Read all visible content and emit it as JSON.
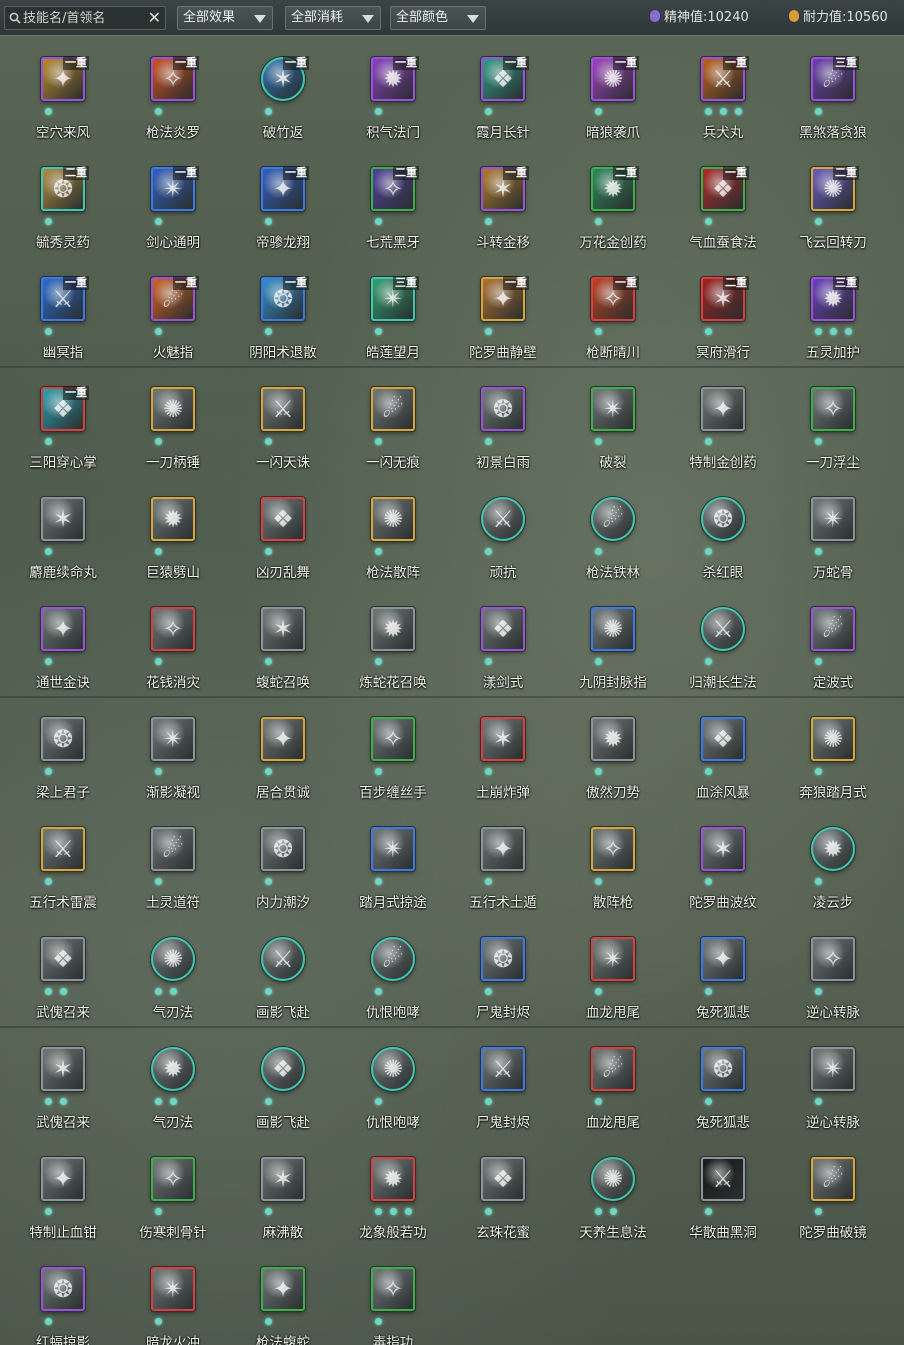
{
  "toolbar": {
    "search_placeholder": "技能名/首领名",
    "clear_glyph": "✕",
    "filter_effect": "全部效果",
    "filter_cost": "全部消耗",
    "filter_color": "全部颜色",
    "spirit_label": "精神值:",
    "spirit_value": "10240",
    "endurance_label": "耐力值:",
    "endurance_value": "10560"
  },
  "skills": [
    {
      "name": "空穴来风",
      "rank": "一重",
      "frame": "purple",
      "color": "#b8892a",
      "dots": 1
    },
    {
      "name": "枪法炎罗",
      "rank": "一重",
      "frame": "purple",
      "color": "#d0501e",
      "dots": 1
    },
    {
      "name": "破竹返",
      "rank": "一重",
      "frame": "teal",
      "color": "#2a6fb0",
      "dots": 1,
      "round": true
    },
    {
      "name": "积气法门",
      "rank": "一重",
      "frame": "purple",
      "color": "#8a3fc0",
      "dots": 1
    },
    {
      "name": "霞月长针",
      "rank": "一重",
      "frame": "purple",
      "color": "#2f9b88",
      "dots": 1
    },
    {
      "name": "暗狼袭爪",
      "rank": "一重",
      "frame": "purple",
      "color": "#a040c0",
      "dots": 1
    },
    {
      "name": "兵犬丸",
      "rank": "一重",
      "frame": "purple",
      "color": "#c0601c",
      "dots": 3
    },
    {
      "name": "黑煞落贪狼",
      "rank": "三重",
      "frame": "purple",
      "color": "#6a40b0",
      "dots": 1
    },
    {
      "name": "毓秀灵药",
      "rank": "二重",
      "frame": "teal",
      "color": "#b08a40",
      "dots": 1
    },
    {
      "name": "剑心通明",
      "rank": "一重",
      "frame": "blue",
      "color": "#3060c0",
      "dots": 1
    },
    {
      "name": "帝骖龙翔",
      "rank": "一重",
      "frame": "blue",
      "color": "#2f5fc0",
      "dots": 1
    },
    {
      "name": "七荒黑牙",
      "rank": "二重",
      "frame": "green",
      "color": "#5040a0",
      "dots": 1
    },
    {
      "name": "斗转金移",
      "rank": "一重",
      "frame": "purple",
      "color": "#b07a28",
      "dots": 1
    },
    {
      "name": "万花金创药",
      "rank": "二重",
      "frame": "green",
      "color": "#2a8a5a",
      "dots": 1
    },
    {
      "name": "气血蚕食法",
      "rank": "一重",
      "frame": "green",
      "color": "#b02a2a",
      "dots": 1
    },
    {
      "name": "飞云回转刀",
      "rank": "二重",
      "frame": "yellow",
      "color": "#6a58c0",
      "dots": 1
    },
    {
      "name": "幽冥指",
      "rank": "一重",
      "frame": "blue",
      "color": "#2a6ad0",
      "dots": 1
    },
    {
      "name": "火魅指",
      "rank": "一重",
      "frame": "purple",
      "color": "#d06020",
      "dots": 1
    },
    {
      "name": "阴阳术退散",
      "rank": "一重",
      "frame": "blue",
      "color": "#3090d0",
      "dots": 1
    },
    {
      "name": "皓莲望月",
      "rank": "三重",
      "frame": "teal",
      "color": "#30a070",
      "dots": 1
    },
    {
      "name": "陀罗曲静壁",
      "rank": "一重",
      "frame": "yellow",
      "color": "#b07030",
      "dots": 1
    },
    {
      "name": "枪断晴川",
      "rank": "一重",
      "frame": "red",
      "color": "#c04020",
      "dots": 1
    },
    {
      "name": "冥府滑行",
      "rank": "二重",
      "frame": "red",
      "color": "#a02020",
      "dots": 1
    },
    {
      "name": "五灵加护",
      "rank": "三重",
      "frame": "purple",
      "color": "#6a40c0",
      "dots": 3
    },
    {
      "name": "三阳穿心掌",
      "rank": "一重",
      "frame": "red",
      "color": "#2aa0b0",
      "dots": 1
    },
    {
      "name": "一刀柄锤",
      "frame": "yellow",
      "color": "#707878",
      "dots": 1
    },
    {
      "name": "一闪天诛",
      "frame": "yellow",
      "color": "#707878",
      "dots": 1
    },
    {
      "name": "一闪无痕",
      "frame": "yellow",
      "color": "#707878",
      "dots": 1
    },
    {
      "name": "初景白雨",
      "frame": "purple",
      "color": "#707878",
      "dots": 1
    },
    {
      "name": "破裂",
      "frame": "green",
      "color": "#707878",
      "dots": 1
    },
    {
      "name": "特制金创药",
      "frame": "gray",
      "color": "#707878",
      "dots": 1
    },
    {
      "name": "一刀浮尘",
      "frame": "green",
      "color": "#707878",
      "dots": 1
    },
    {
      "name": "麝鹿续命丸",
      "frame": "gray",
      "color": "#707878",
      "dots": 1
    },
    {
      "name": "巨猿劈山",
      "frame": "yellow",
      "color": "#707878",
      "dots": 1
    },
    {
      "name": "凶刃乱舞",
      "frame": "red",
      "color": "#707878",
      "dots": 1
    },
    {
      "name": "枪法散阵",
      "frame": "yellow",
      "color": "#707878",
      "dots": 1
    },
    {
      "name": "顽抗",
      "frame": "teal",
      "color": "#707878",
      "dots": 1,
      "round": true
    },
    {
      "name": "枪法铁林",
      "frame": "teal",
      "color": "#707878",
      "dots": 1,
      "round": true
    },
    {
      "name": "杀红眼",
      "frame": "teal",
      "color": "#707878",
      "dots": 1,
      "round": true
    },
    {
      "name": "万蛇骨",
      "frame": "gray",
      "color": "#707878",
      "dots": 1
    },
    {
      "name": "通世金诀",
      "frame": "purple",
      "color": "#707878",
      "dots": 1
    },
    {
      "name": "花钱消灾",
      "frame": "red",
      "color": "#707878",
      "dots": 1
    },
    {
      "name": "蝮蛇召唤",
      "frame": "gray",
      "color": "#707878",
      "dots": 1
    },
    {
      "name": "炼蛇花召唤",
      "frame": "gray",
      "color": "#707878",
      "dots": 1
    },
    {
      "name": "漾剑式",
      "frame": "purple",
      "color": "#707878",
      "dots": 1
    },
    {
      "name": "九阴封脉指",
      "frame": "blue",
      "color": "#707878",
      "dots": 1
    },
    {
      "name": "归潮长生法",
      "frame": "teal",
      "color": "#707878",
      "dots": 1,
      "round": true
    },
    {
      "name": "定波式",
      "frame": "purple",
      "color": "#707878",
      "dots": 1
    },
    {
      "name": "梁上君子",
      "frame": "gray",
      "color": "#707878",
      "dots": 1
    },
    {
      "name": "渐影凝视",
      "frame": "gray",
      "color": "#707878",
      "dots": 1
    },
    {
      "name": "居合贯诚",
      "frame": "yellow",
      "color": "#707878",
      "dots": 1
    },
    {
      "name": "百步缠丝手",
      "frame": "green",
      "color": "#707878",
      "dots": 1
    },
    {
      "name": "土崩炸弹",
      "frame": "red",
      "color": "#707878",
      "dots": 1
    },
    {
      "name": "傲然刀势",
      "frame": "gray",
      "color": "#707878",
      "dots": 1
    },
    {
      "name": "血涂风暴",
      "frame": "blue",
      "color": "#707878",
      "dots": 1
    },
    {
      "name": "奔狼踏月式",
      "frame": "yellow",
      "color": "#707878",
      "dots": 1
    },
    {
      "name": "五行术雷震",
      "frame": "yellow",
      "color": "#707878",
      "dots": 1
    },
    {
      "name": "土灵道符",
      "frame": "gray",
      "color": "#707878",
      "dots": 1
    },
    {
      "name": "内力潮汐",
      "frame": "gray",
      "color": "#707878",
      "dots": 1
    },
    {
      "name": "踏月式掠途",
      "frame": "blue",
      "color": "#707878",
      "dots": 1
    },
    {
      "name": "五行术土遁",
      "frame": "gray",
      "color": "#707878",
      "dots": 1
    },
    {
      "name": "散阵枪",
      "frame": "yellow",
      "color": "#707878",
      "dots": 1
    },
    {
      "name": "陀罗曲波纹",
      "frame": "purple",
      "color": "#707878",
      "dots": 1
    },
    {
      "name": "凌云步",
      "frame": "teal",
      "color": "#707878",
      "dots": 1,
      "round": true
    },
    {
      "name": "武傀召来",
      "frame": "gray",
      "color": "#707878",
      "dots": 2
    },
    {
      "name": "气刃法",
      "frame": "teal",
      "color": "#707878",
      "dots": 2,
      "round": true
    },
    {
      "name": "画影飞赴",
      "frame": "teal",
      "color": "#707878",
      "dots": 1,
      "round": true
    },
    {
      "name": "仇恨咆哮",
      "frame": "teal",
      "color": "#707878",
      "dots": 1,
      "round": true
    },
    {
      "name": "尸鬼封烬",
      "frame": "blue",
      "color": "#707878",
      "dots": 1
    },
    {
      "name": "血龙甩尾",
      "frame": "red",
      "color": "#707878",
      "dots": 1
    },
    {
      "name": "兔死狐悲",
      "frame": "blue",
      "color": "#707878",
      "dots": 1
    },
    {
      "name": "逆心转脉",
      "frame": "gray",
      "color": "#707878",
      "dots": 1
    },
    {
      "name": "武傀召来",
      "frame": "gray",
      "color": "#707878",
      "dots": 2
    },
    {
      "name": "气刃法",
      "frame": "teal",
      "color": "#707878",
      "dots": 2,
      "round": true
    },
    {
      "name": "画影飞赴",
      "frame": "teal",
      "color": "#707878",
      "dots": 1,
      "round": true
    },
    {
      "name": "仇恨咆哮",
      "frame": "teal",
      "color": "#707878",
      "dots": 1,
      "round": true
    },
    {
      "name": "尸鬼封烬",
      "frame": "blue",
      "color": "#707878",
      "dots": 1
    },
    {
      "name": "血龙甩尾",
      "frame": "red",
      "color": "#707878",
      "dots": 1
    },
    {
      "name": "兔死狐悲",
      "frame": "blue",
      "color": "#707878",
      "dots": 1
    },
    {
      "name": "逆心转脉",
      "frame": "gray",
      "color": "#707878",
      "dots": 1
    },
    {
      "name": "特制止血钳",
      "frame": "gray",
      "color": "#707878",
      "dots": 1
    },
    {
      "name": "伤寒刺骨针",
      "frame": "green",
      "color": "#707878",
      "dots": 1
    },
    {
      "name": "麻沸散",
      "frame": "gray",
      "color": "#707878",
      "dots": 1
    },
    {
      "name": "龙象般若功",
      "frame": "red",
      "color": "#707878",
      "dots": 3
    },
    {
      "name": "玄珠花蜜",
      "frame": "gray",
      "color": "#707878",
      "dots": 1
    },
    {
      "name": "天养生息法",
      "frame": "teal",
      "color": "#707878",
      "dots": 2,
      "round": true
    },
    {
      "name": "华散曲黑洞",
      "frame": "gray",
      "color": "#1a1a1a",
      "dots": 1
    },
    {
      "name": "陀罗曲破镜",
      "frame": "yellow",
      "color": "#707878",
      "dots": 1
    },
    {
      "name": "红蝠掠影",
      "frame": "purple",
      "color": "#707878",
      "dots": 1
    },
    {
      "name": "暗龙火冲",
      "frame": "red",
      "color": "#707878",
      "dots": 1
    },
    {
      "name": "枪法蝮蛇",
      "frame": "green",
      "color": "#707878",
      "dots": 1
    },
    {
      "name": "毒指功",
      "frame": "green",
      "color": "#707878",
      "dots": 1
    }
  ],
  "frame_colors": {
    "purple": "#9a52d8",
    "teal": "#3fc7b0",
    "blue": "#3f78e0",
    "green": "#3fae4a",
    "yellow": "#d6a63a",
    "red": "#d84040",
    "gray": "#8a949a"
  }
}
